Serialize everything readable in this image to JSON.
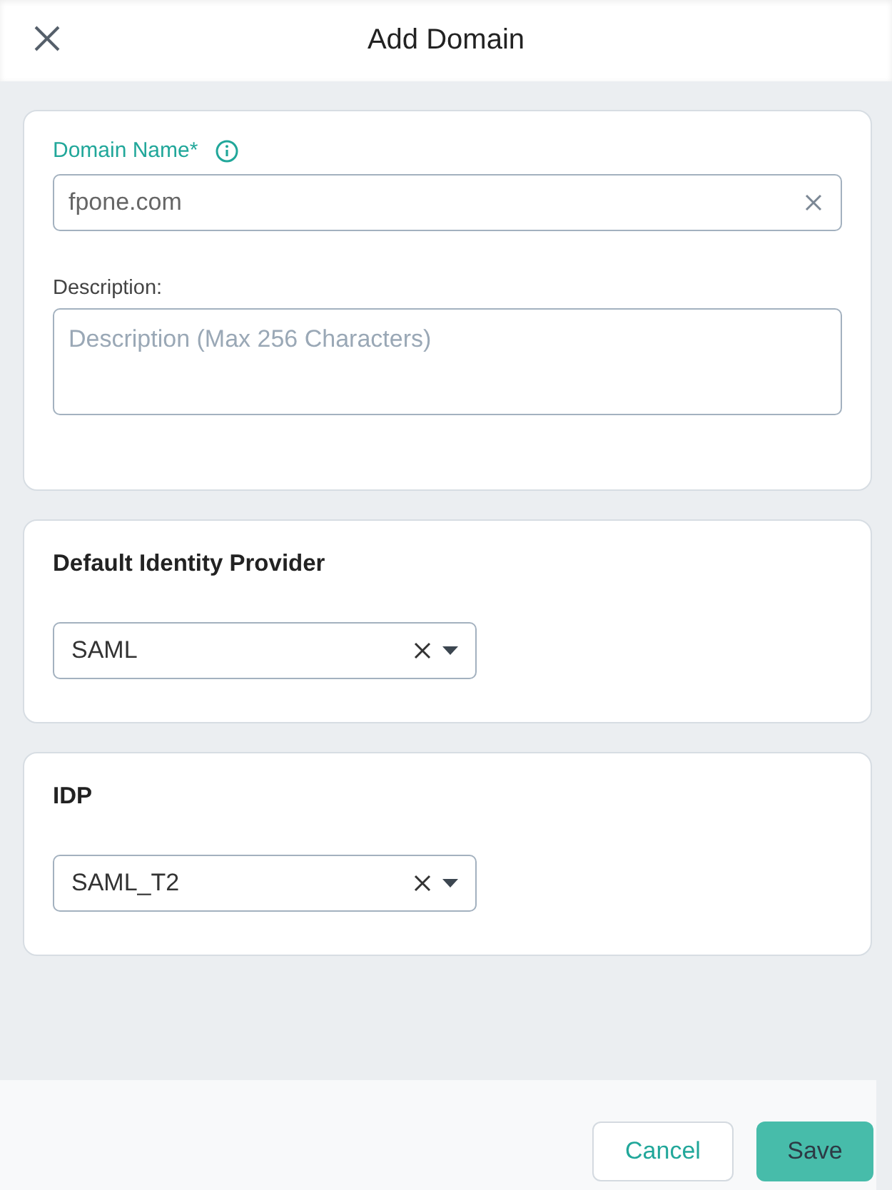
{
  "header": {
    "title": "Add Domain"
  },
  "domain_card": {
    "domain_name": {
      "label": "Domain Name*",
      "value": "fpone.com"
    },
    "description": {
      "label": "Description:",
      "placeholder": "Description (Max 256 Characters)"
    }
  },
  "selects": [
    {
      "heading": "Default Identity Provider",
      "value": "SAML"
    },
    {
      "heading": "IDP",
      "value": "SAML_T2"
    }
  ],
  "footer": {
    "buttons": [
      {
        "label": "Cancel",
        "kind": "secondary"
      },
      {
        "label": "Save",
        "kind": "primary"
      }
    ]
  }
}
